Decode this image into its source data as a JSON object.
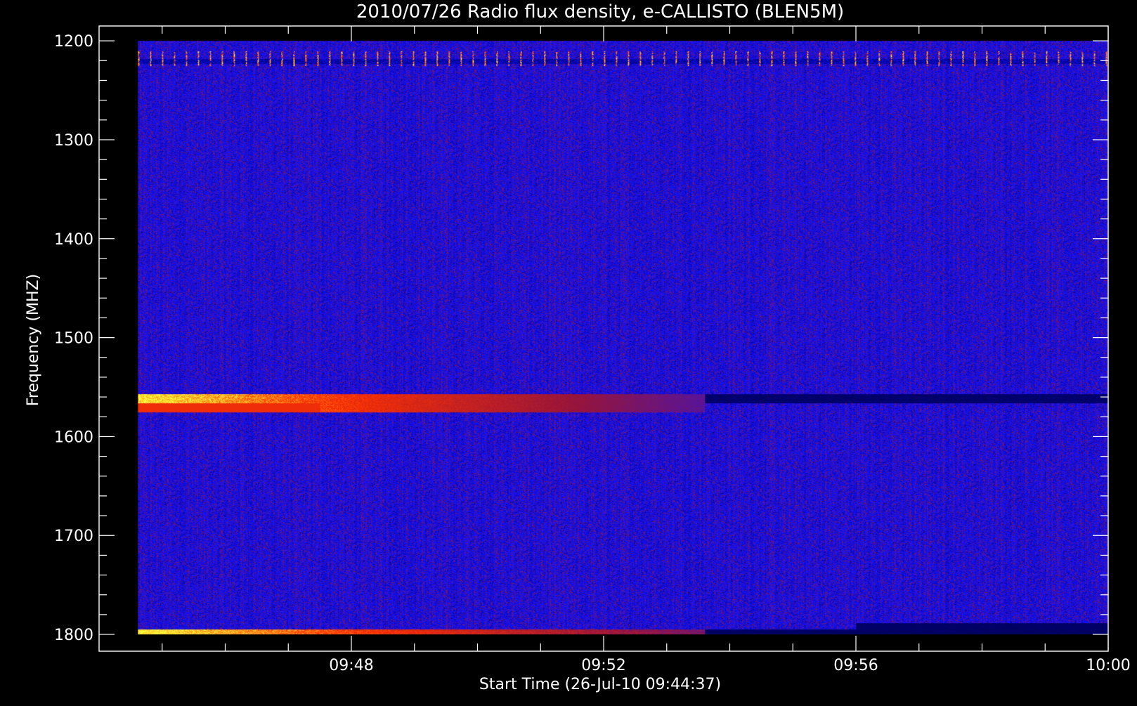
{
  "chart_data": {
    "type": "heatmap",
    "title": "2010/07/26  Radio flux density, e-CALLISTO (BLEN5M)",
    "xlabel": "Start Time (26-Jul-10 09:44:37)",
    "ylabel": "Frequency (MHZ)",
    "x_tick_labels": [
      "09:48",
      "09:52",
      "09:56",
      "10:00"
    ],
    "y_tick_labels": [
      "1200",
      "1300",
      "1400",
      "1500",
      "1600",
      "1700",
      "1800"
    ],
    "y_ticks": [
      1200,
      1300,
      1400,
      1500,
      1600,
      1700,
      1800
    ],
    "y_axis_inverted": true,
    "x_range_minutes_after_09_44": [
      0,
      16
    ],
    "data_range_minutes_after_09_44": [
      0.617,
      16.0
    ],
    "y_range_mhz": [
      1185,
      1817
    ],
    "data_freq_range_mhz": [
      1200,
      1800
    ],
    "colormap": "blue-red-yellow",
    "colors": {
      "background": "#000000",
      "axis": "#ffffff",
      "low": "#1a1aff",
      "mid": "#8a1a3a",
      "high": "#ff3000",
      "peak": "#ffff60"
    },
    "features": [
      {
        "description_label": "",
        "freq_mhz": 1562,
        "start_min": 0.617,
        "end_min": 9.6,
        "intensity": "high, decaying"
      },
      {
        "description_label": "",
        "freq_mhz": 1800,
        "start_min": 0.617,
        "end_min": 9.6,
        "intensity": "high, decaying"
      },
      {
        "description_label": "",
        "freq_mhz": 1217,
        "start_min": 0.617,
        "end_min": 16.0,
        "intensity": "periodic spikes"
      }
    ]
  }
}
